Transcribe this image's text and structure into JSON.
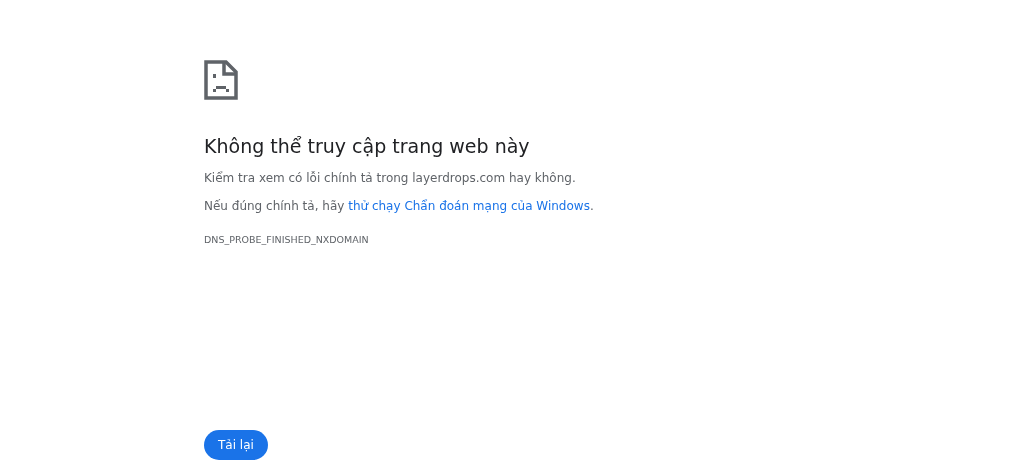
{
  "title": "Không thể truy cập trang web này",
  "check_text": "Kiểm tra xem có lỗi chính tả trong layerdrops.com hay không.",
  "suggestion": {
    "before": "Nếu đúng chính tả, hãy ",
    "link": "thử chạy Chẩn đoán mạng của Windows",
    "after": "."
  },
  "error_code": "DNS_PROBE_FINISHED_NXDOMAIN",
  "reload_button": "Tải lại"
}
